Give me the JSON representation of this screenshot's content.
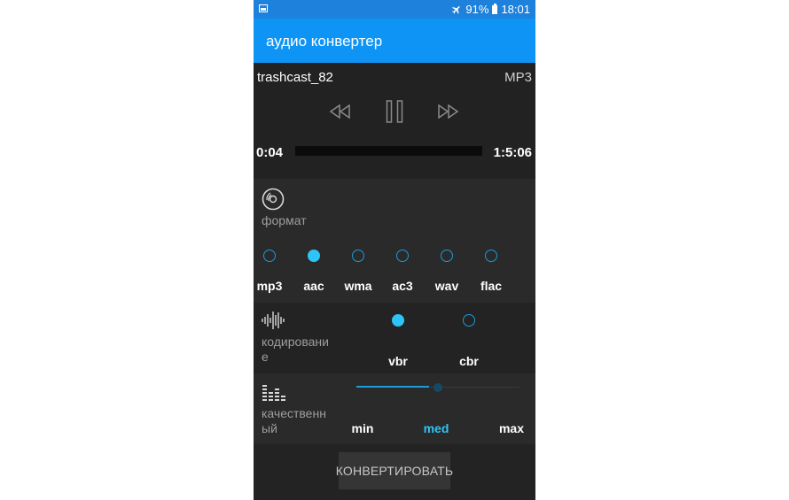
{
  "status_bar": {
    "battery_percent": "91%",
    "time": "18:01",
    "icons": [
      "gallery-icon",
      "airplane-icon",
      "battery-icon"
    ]
  },
  "app_bar": {
    "title": "аудио конвертер"
  },
  "player": {
    "track_name": "trashcast_82",
    "format": "MP3",
    "elapsed": "0:04",
    "duration": "1:5:06",
    "progress_fraction": 0.0,
    "icons": [
      "rewind-icon",
      "pause-icon",
      "fast-forward-icon"
    ]
  },
  "format_section": {
    "label": "формат",
    "icon": "disc-icon",
    "options": [
      "mp3",
      "aac",
      "wma",
      "ac3",
      "wav",
      "flac"
    ],
    "selected": "aac"
  },
  "encoding_section": {
    "label_line1": "кодировани",
    "label_line2": "е",
    "icon": "waveform-icon",
    "options": [
      "vbr",
      "cbr"
    ],
    "selected": "vbr"
  },
  "quality_section": {
    "label_line1": "качественн",
    "label_line2": "ый",
    "icon": "equalizer-icon",
    "levels": [
      "min",
      "med",
      "max"
    ],
    "selected": "med",
    "slider_value_fraction": 0.5
  },
  "convert_button": {
    "label": "КОНВЕРТИРОВАТЬ"
  },
  "colors": {
    "status_bar": "#1e82dd",
    "app_bar": "#0e94f4",
    "accent": "#2ec4f7",
    "background": "#262626"
  }
}
